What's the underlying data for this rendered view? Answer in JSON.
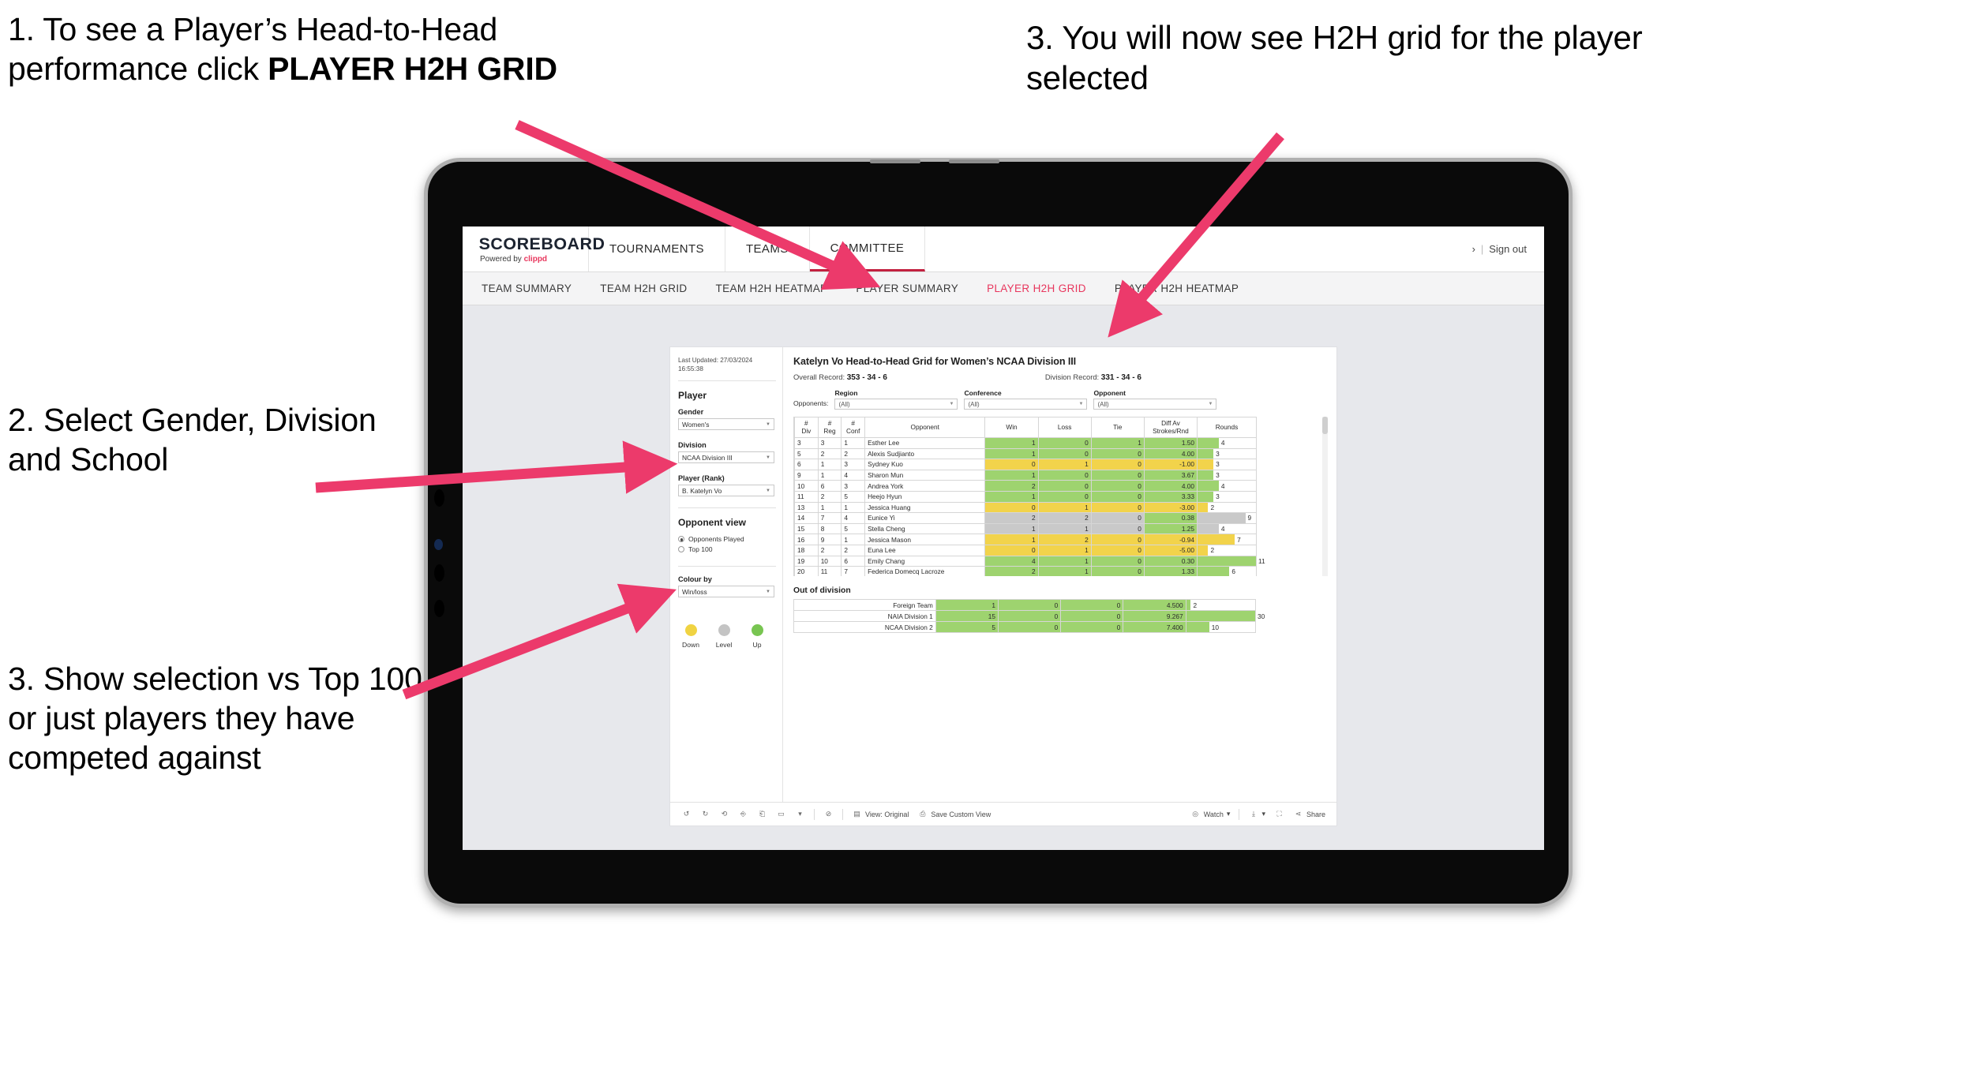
{
  "annotations": {
    "a1_line1": "1. To see a Player’s Head-to-Head performance click ",
    "a1_bold": "PLAYER H2H GRID",
    "a2": "2. Select Gender, Division and School",
    "a3": "3. Show selection vs Top 100 or just players they have competed against",
    "a4": "3. You will now see H2H grid for the player selected"
  },
  "brand": {
    "name": "SCOREBOARD",
    "powered_prefix": "Powered by ",
    "powered_brand": "clippd"
  },
  "topnav": {
    "items": [
      "TOURNAMENTS",
      "TEAMS",
      "COMMITTEE"
    ],
    "active": "COMMITTEE",
    "account_chevron": "›",
    "separator": "|",
    "signout": "Sign out"
  },
  "subnav": {
    "items": [
      "TEAM SUMMARY",
      "TEAM H2H GRID",
      "TEAM H2H HEATMAP",
      "PLAYER SUMMARY",
      "PLAYER H2H GRID",
      "PLAYER H2H HEATMAP"
    ],
    "active": "PLAYER H2H GRID",
    "active_color": "#e8365d"
  },
  "filters": {
    "last_updated": "Last Updated: 27/03/2024 16:55:38",
    "player_heading": "Player",
    "gender_label": "Gender",
    "gender_value": "Women's",
    "division_label": "Division",
    "division_value": "NCAA Division III",
    "player_rank_label": "Player (Rank)",
    "player_rank_value": "B. Katelyn Vo",
    "opponent_view_heading": "Opponent view",
    "opponent_view_options": [
      "Opponents Played",
      "Top 100"
    ],
    "opponent_view_selected": "Opponents Played",
    "colour_by_label": "Colour by",
    "colour_by_value": "Win/loss",
    "legend": [
      {
        "label": "Down",
        "color": "#f0d342"
      },
      {
        "label": "Level",
        "color": "#c4c4c4"
      },
      {
        "label": "Up",
        "color": "#78c551"
      }
    ]
  },
  "viz": {
    "title": "Katelyn Vo Head-to-Head Grid for Women’s NCAA Division III",
    "overall_record_label": "Overall Record:",
    "overall_record_value": "353 -  34 - 6",
    "division_record_label": "Division Record:",
    "division_record_value": "331 -  34 - 6",
    "opponents_label": "Opponents:",
    "opp_filters": [
      {
        "caption": "Region",
        "value": "(All)"
      },
      {
        "caption": "Conference",
        "value": "(All)"
      },
      {
        "caption": "Opponent",
        "value": "(All)"
      }
    ],
    "out_of_division_heading": "Out of division"
  },
  "chart_data": {
    "type": "table",
    "title": "Katelyn Vo Head-to-Head Grid for Women’s NCAA Division III",
    "columns": [
      "# Div",
      "# Reg",
      "# Conf",
      "Opponent",
      "Win",
      "Loss",
      "Tie",
      "Diff Av Strokes/Rnd",
      "Rounds"
    ],
    "column_headers_multiline": [
      [
        "#",
        "Div"
      ],
      [
        "#",
        "Reg"
      ],
      [
        "#",
        "Conf"
      ],
      [
        "Opponent"
      ],
      [
        "Win"
      ],
      [
        "Loss"
      ],
      [
        "Tie"
      ],
      [
        "Diff Av",
        "Strokes/Rnd"
      ],
      [
        "Rounds"
      ]
    ],
    "rounds_max": 11,
    "rows": [
      {
        "div": "3",
        "reg": "3",
        "conf": "1",
        "opponent": "Esther Lee",
        "win": "1",
        "loss": "0",
        "tie": "1",
        "diff": "1.50",
        "rounds": "4",
        "state": "green"
      },
      {
        "div": "5",
        "reg": "2",
        "conf": "2",
        "opponent": "Alexis Sudjianto",
        "win": "1",
        "loss": "0",
        "tie": "0",
        "diff": "4.00",
        "rounds": "3",
        "state": "green"
      },
      {
        "div": "6",
        "reg": "1",
        "conf": "3",
        "opponent": "Sydney Kuo",
        "win": "0",
        "loss": "1",
        "tie": "0",
        "diff": "-1.00",
        "rounds": "3",
        "state": "yellow"
      },
      {
        "div": "9",
        "reg": "1",
        "conf": "4",
        "opponent": "Sharon Mun",
        "win": "1",
        "loss": "0",
        "tie": "0",
        "diff": "3.67",
        "rounds": "3",
        "state": "green"
      },
      {
        "div": "10",
        "reg": "6",
        "conf": "3",
        "opponent": "Andrea York",
        "win": "2",
        "loss": "0",
        "tie": "0",
        "diff": "4.00",
        "rounds": "4",
        "state": "green"
      },
      {
        "div": "11",
        "reg": "2",
        "conf": "5",
        "opponent": "Heejo Hyun",
        "win": "1",
        "loss": "0",
        "tie": "0",
        "diff": "3.33",
        "rounds": "3",
        "state": "green"
      },
      {
        "div": "13",
        "reg": "1",
        "conf": "1",
        "opponent": "Jessica Huang",
        "win": "0",
        "loss": "1",
        "tie": "0",
        "diff": "-3.00",
        "rounds": "2",
        "state": "yellow"
      },
      {
        "div": "14",
        "reg": "7",
        "conf": "4",
        "opponent": "Eunice Yi",
        "win": "2",
        "loss": "2",
        "tie": "0",
        "diff": "0.38",
        "rounds": "9",
        "state": "grey",
        "diff_state": "green"
      },
      {
        "div": "15",
        "reg": "8",
        "conf": "5",
        "opponent": "Stella Cheng",
        "win": "1",
        "loss": "1",
        "tie": "0",
        "diff": "1.25",
        "rounds": "4",
        "state": "grey",
        "diff_state": "green"
      },
      {
        "div": "16",
        "reg": "9",
        "conf": "1",
        "opponent": "Jessica Mason",
        "win": "1",
        "loss": "2",
        "tie": "0",
        "diff": "-0.94",
        "rounds": "7",
        "state": "yellow"
      },
      {
        "div": "18",
        "reg": "2",
        "conf": "2",
        "opponent": "Euna Lee",
        "win": "0",
        "loss": "1",
        "tie": "0",
        "diff": "-5.00",
        "rounds": "2",
        "state": "yellow"
      },
      {
        "div": "19",
        "reg": "10",
        "conf": "6",
        "opponent": "Emily Chang",
        "win": "4",
        "loss": "1",
        "tie": "0",
        "diff": "0.30",
        "rounds": "11",
        "state": "green"
      },
      {
        "div": "20",
        "reg": "11",
        "conf": "7",
        "opponent": "Federica Domecq Lacroze",
        "win": "2",
        "loss": "1",
        "tie": "0",
        "diff": "1.33",
        "rounds": "6",
        "state": "green"
      }
    ],
    "out_of_division": {
      "heading": "Out of division",
      "rounds_max": 30,
      "rows": [
        {
          "name": "Foreign Team",
          "win": "1",
          "loss": "0",
          "tie": "0",
          "diff": "4.500",
          "rounds": "2",
          "state": "green"
        },
        {
          "name": "NAIA Division 1",
          "win": "15",
          "loss": "0",
          "tie": "0",
          "diff": "9.267",
          "rounds": "30",
          "state": "green"
        },
        {
          "name": "NCAA Division 2",
          "win": "5",
          "loss": "0",
          "tie": "0",
          "diff": "7.400",
          "rounds": "10",
          "state": "green"
        }
      ]
    }
  },
  "toolbar": {
    "view_original": "View: Original",
    "save_custom_view": "Save Custom View",
    "watch": "Watch",
    "watch_caret": "▾",
    "share": "Share",
    "download_caret": "▾",
    "pan_caret": "▾"
  },
  "colors": {
    "accent_pink": "#e8365d",
    "arrow_pink": "#ec3a6b",
    "green": "#9ed36f",
    "yellow": "#f2d34b",
    "grey": "#c9c9c9"
  }
}
